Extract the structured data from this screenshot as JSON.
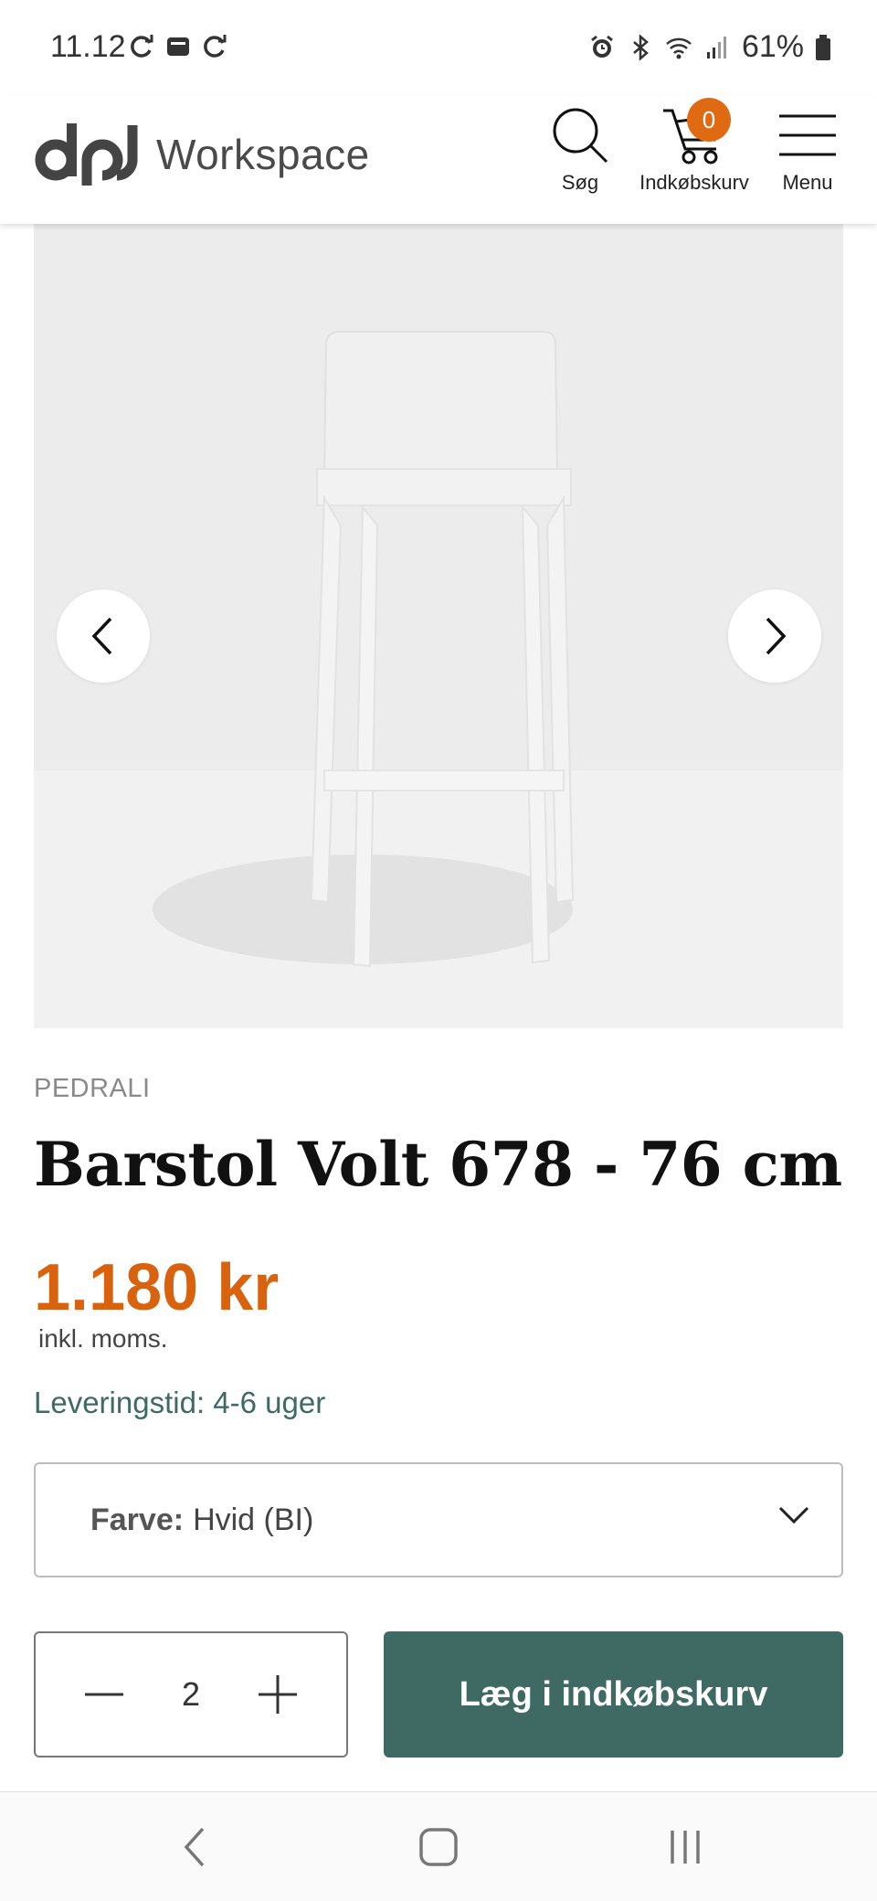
{
  "status_bar": {
    "time": "11.12",
    "battery": "61%",
    "icons": [
      "sync-icon",
      "sim-icon",
      "sync-icon",
      "alarm-icon",
      "bluetooth-icon",
      "wifi-icon",
      "signal-icon",
      "battery-icon"
    ]
  },
  "header": {
    "logo_text": "Workspace",
    "search_label": "Søg",
    "cart_label": "Indkøbskurv",
    "cart_count": "0",
    "menu_label": "Menu"
  },
  "product": {
    "brand": "PEDRALI",
    "title": "Barstol Volt 678 - 76 cm",
    "price": "1.180 kr",
    "vat_note": "inkl. moms.",
    "delivery": "Leveringstid: 4-6 uger",
    "color_label": "Farve:",
    "color_value": "Hvid (BI)",
    "quantity": "2",
    "add_to_cart": "Læg i indkøbskurv"
  },
  "colors": {
    "accent_orange": "#d9620e",
    "accent_green": "#3f6a64"
  }
}
